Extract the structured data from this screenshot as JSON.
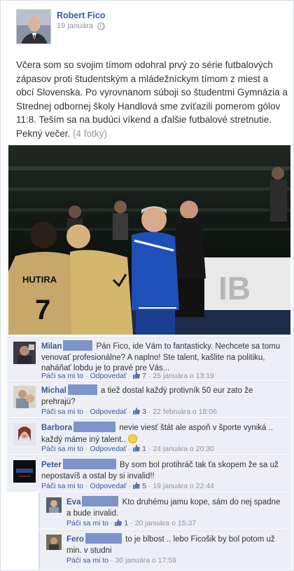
{
  "post": {
    "author": "Robert Fico",
    "date": "19 januára",
    "text": "Včera som so svojim tímom odohral prvý zo série futbalových zápasov proti študentským a mládežníckym tímom z miest a obcí Slovenska. Po vyrovnanom súboji so študentmi Gymnázia a Strednej odbornej školy Handlová sme zvíťazili pomerom gólov 11:8. Teším sa na budúci víkend a ďalšie futbalové stretnutie. Pekný večer.",
    "photo_link": "(4 fotky)",
    "photo_jersey_text": "HUTIRA",
    "photo_jersey_number": "7",
    "photo_banner_text": "IB"
  },
  "ui": {
    "like_label": "Páči sa mi to",
    "reply_label": "Odpovedať",
    "separator": "·"
  },
  "comments": [
    {
      "name": "Milan",
      "text": "Pán Fico, ide Vám to fantasticky. Nechcete sa tomu venovať profesionálne? A naplno! Ste talent, kašlite na politiku, naháňať lobdu je to pravé pre Vás...",
      "likes": "7",
      "date": "25 januára o 13:19"
    },
    {
      "name": "Michal",
      "text": "a tiež dostal každý protivník 50 eur zato že prehrajú?",
      "likes": "3",
      "date": "22 februára o 18:06"
    },
    {
      "name": "Barbora",
      "text": "nevie viesť štát ale aspoň v športe vyniká .. každý máme iný talent..",
      "likes": "1",
      "date": "24 januára o 20:30"
    },
    {
      "name": "Peter",
      "text": "By som bol protihráč tak ťa skopem že sa už nepostavíš a ostal by si invalid!!",
      "likes": "5",
      "date": "19 januára o 22:44"
    },
    {
      "name": "Eva",
      "text": "Kto druhému jamu kope, sám do nej spadne a bude invalid.",
      "likes": "1",
      "date": "20 januára o 15:37"
    },
    {
      "name": "Fero",
      "text": "to je blbost .. lebo Ficošik by bol potom už min. v studni",
      "likes": "",
      "date": "30 januára o 17:59"
    }
  ],
  "icons": {
    "privacy": "globe-icon",
    "like": "thumbs-up-icon",
    "emoticon": "smiley-icon"
  },
  "colors": {
    "link": "#3b5998",
    "meta": "#90949c",
    "comment_bg": "#eceff5",
    "redaction": "#7d94c9"
  }
}
